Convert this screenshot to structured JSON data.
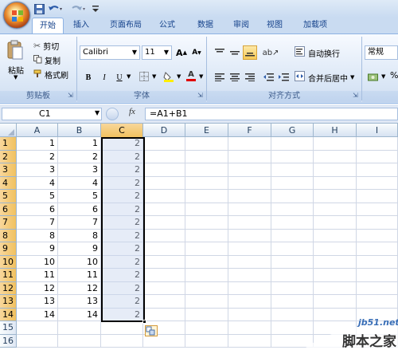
{
  "titlebar": {
    "qat": {
      "save_icon": "save-icon",
      "undo_icon": "undo-icon",
      "redo_icon": "redo-icon",
      "customize_icon": "chevron-down-icon"
    }
  },
  "tabs": [
    {
      "label": "开始",
      "active": true
    },
    {
      "label": "插入"
    },
    {
      "label": "页面布局"
    },
    {
      "label": "公式"
    },
    {
      "label": "数据"
    },
    {
      "label": "审阅"
    },
    {
      "label": "视图"
    },
    {
      "label": "加载项"
    }
  ],
  "ribbon": {
    "clipboard": {
      "group_label": "剪贴板",
      "paste_label": "粘贴",
      "cut_label": "剪切",
      "copy_label": "复制",
      "format_painter_label": "格式刷"
    },
    "font": {
      "group_label": "字体",
      "font_name": "Calibri",
      "font_size": "11",
      "grow_label": "A",
      "shrink_label": "A",
      "bold_label": "B",
      "italic_label": "I",
      "underline_label": "U",
      "fontcolor_label": "A"
    },
    "alignment": {
      "group_label": "对齐方式",
      "wrap_text_label": "自动换行",
      "merge_center_label": "合并后居中"
    },
    "number": {
      "format_value": "常规"
    }
  },
  "formula_bar": {
    "name_box": "C1",
    "fx_label": "fx",
    "formula": "=A1+B1"
  },
  "columns": [
    "A",
    "B",
    "C",
    "D",
    "E",
    "F",
    "G",
    "H",
    "I"
  ],
  "rows": [
    {
      "num": "1",
      "a": "1",
      "b": "1",
      "c": "2"
    },
    {
      "num": "2",
      "a": "2",
      "b": "2",
      "c": "2"
    },
    {
      "num": "3",
      "a": "3",
      "b": "3",
      "c": "2"
    },
    {
      "num": "4",
      "a": "4",
      "b": "4",
      "c": "2"
    },
    {
      "num": "5",
      "a": "5",
      "b": "5",
      "c": "2"
    },
    {
      "num": "6",
      "a": "6",
      "b": "6",
      "c": "2"
    },
    {
      "num": "7",
      "a": "7",
      "b": "7",
      "c": "2"
    },
    {
      "num": "8",
      "a": "8",
      "b": "8",
      "c": "2"
    },
    {
      "num": "9",
      "a": "9",
      "b": "9",
      "c": "2"
    },
    {
      "num": "10",
      "a": "10",
      "b": "10",
      "c": "2"
    },
    {
      "num": "11",
      "a": "11",
      "b": "11",
      "c": "2"
    },
    {
      "num": "12",
      "a": "12",
      "b": "12",
      "c": "2"
    },
    {
      "num": "13",
      "a": "13",
      "b": "13",
      "c": "2"
    },
    {
      "num": "14",
      "a": "14",
      "b": "14",
      "c": "2"
    },
    {
      "num": "15",
      "a": "",
      "b": "",
      "c": ""
    },
    {
      "num": "16",
      "a": "",
      "b": "",
      "c": ""
    }
  ],
  "watermark": {
    "site": "jb51.net",
    "brand": "脚本之家"
  },
  "colors": {
    "accent": "#15428b",
    "selection_header": "#f1c15f",
    "ribbon_bg": "#dbe7f6"
  }
}
